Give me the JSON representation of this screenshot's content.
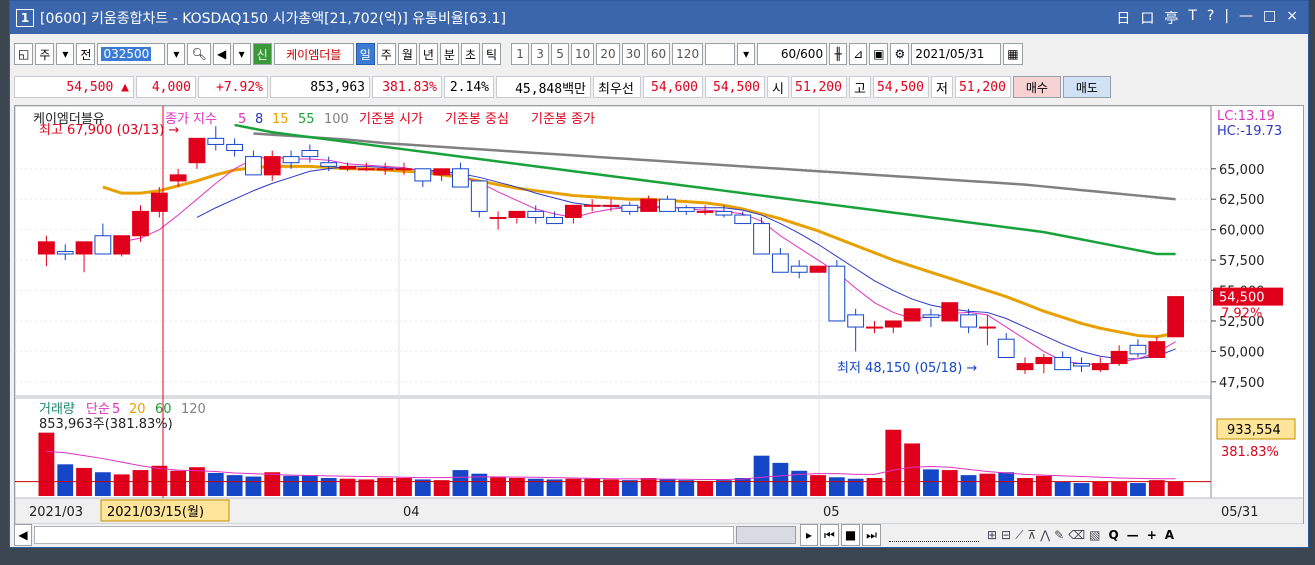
{
  "window": {
    "badge": "1",
    "title": "[0600] 키움종합차트 - KOSDAQ150 시가총액[21,702(억)] 유통비율[63.1]",
    "controls": [
      "日",
      "口",
      "亭",
      "T",
      "?",
      "|",
      "—",
      "□",
      "×"
    ]
  },
  "toolbar": {
    "item_jong": "주",
    "item_jeon": "전",
    "code": "032500",
    "shin": "신",
    "stock_name": "케이엠더블",
    "periods": [
      "일",
      "주",
      "월",
      "년",
      "분",
      "초",
      "틱"
    ],
    "active_period": "일",
    "minutes": [
      "1",
      "3",
      "5",
      "10",
      "20",
      "30",
      "60",
      "120"
    ],
    "count": "60",
    "count_total": "/600",
    "date": "2021/05/31"
  },
  "quote": {
    "price": "54,500",
    "change": "4,000",
    "rate": "+7.92%",
    "volume": "853,963",
    "vol_rate": "381.83%",
    "turnover": "2.14%",
    "amount": "45,848백만",
    "best_label": "최우선",
    "best_ask": "54,600",
    "best_bid": "54,500",
    "open_label": "시",
    "open": "51,200",
    "high_label": "고",
    "high": "54,500",
    "low_label": "저",
    "low": "51,200",
    "buy": "매수",
    "sell": "매도"
  },
  "chart_data": {
    "type": "candlestick",
    "price_legend": "케이엠더블유",
    "ma_legend": [
      "종가 지수",
      "5",
      "8",
      "15",
      "55",
      "100",
      "기준봉 시가",
      "기준봉 중심",
      "기준봉 종가"
    ],
    "lc": "LC:13.19",
    "hc": "HC:-19.73",
    "high_annot": "최고 67,900 (03/13) →",
    "low_annot": "최저 48,150 (05/18) →",
    "last_price": "54,500",
    "last_rate": "7.92%",
    "y_ticks": [
      "65,000",
      "62,500",
      "60,000",
      "57,500",
      "55,000",
      "52,500",
      "50,000",
      "47,500"
    ],
    "y_range": [
      46500,
      69500
    ],
    "vol_legend": [
      "거래량",
      "단순",
      "5",
      "20",
      "60",
      "120"
    ],
    "vol_annot": "853,963주(381.83%)",
    "vol_last": "933,554",
    "vol_rate": "381.83%",
    "vol_max": 1000000,
    "x_labels": [
      "2021/03",
      "04",
      "05",
      "05/31"
    ],
    "cursor_date": "2021/03/15(월)",
    "candles": [
      {
        "o": 58000,
        "h": 59500,
        "l": 57000,
        "c": 59000
      },
      {
        "o": 58200,
        "h": 58800,
        "l": 57500,
        "c": 58000
      },
      {
        "o": 58000,
        "h": 59000,
        "l": 56500,
        "c": 59000
      },
      {
        "o": 59500,
        "h": 60500,
        "l": 58000,
        "c": 58000
      },
      {
        "o": 58000,
        "h": 59500,
        "l": 57800,
        "c": 59500
      },
      {
        "o": 59500,
        "h": 62000,
        "l": 59000,
        "c": 61500
      },
      {
        "o": 61500,
        "h": 63500,
        "l": 61000,
        "c": 63000
      },
      {
        "o": 64000,
        "h": 65000,
        "l": 63500,
        "c": 64500
      },
      {
        "o": 65500,
        "h": 67500,
        "l": 65000,
        "c": 67500
      },
      {
        "o": 67500,
        "h": 68500,
        "l": 66500,
        "c": 67000
      },
      {
        "o": 67000,
        "h": 67500,
        "l": 66000,
        "c": 66500
      },
      {
        "o": 66000,
        "h": 66500,
        "l": 64500,
        "c": 64500
      },
      {
        "o": 64500,
        "h": 66500,
        "l": 64000,
        "c": 66000
      },
      {
        "o": 66000,
        "h": 66500,
        "l": 65000,
        "c": 65500
      },
      {
        "o": 66500,
        "h": 67000,
        "l": 65500,
        "c": 66000
      },
      {
        "o": 65500,
        "h": 66000,
        "l": 64800,
        "c": 65200
      },
      {
        "o": 65000,
        "h": 65500,
        "l": 64800,
        "c": 65200
      },
      {
        "o": 65000,
        "h": 65500,
        "l": 64800,
        "c": 65000
      },
      {
        "o": 65000,
        "h": 65500,
        "l": 64500,
        "c": 65000
      },
      {
        "o": 65000,
        "h": 65500,
        "l": 64500,
        "c": 65000
      },
      {
        "o": 65000,
        "h": 65000,
        "l": 63500,
        "c": 64000
      },
      {
        "o": 64500,
        "h": 65000,
        "l": 64000,
        "c": 65000
      },
      {
        "o": 65000,
        "h": 65500,
        "l": 63500,
        "c": 63500
      },
      {
        "o": 64000,
        "h": 64000,
        "l": 61000,
        "c": 61500
      },
      {
        "o": 61000,
        "h": 61500,
        "l": 60000,
        "c": 61000
      },
      {
        "o": 61000,
        "h": 61500,
        "l": 60500,
        "c": 61500
      },
      {
        "o": 61500,
        "h": 62000,
        "l": 60500,
        "c": 61000
      },
      {
        "o": 61000,
        "h": 61500,
        "l": 60500,
        "c": 60500
      },
      {
        "o": 61000,
        "h": 62000,
        "l": 60500,
        "c": 62000
      },
      {
        "o": 62000,
        "h": 62500,
        "l": 61500,
        "c": 62000
      },
      {
        "o": 62000,
        "h": 62500,
        "l": 61500,
        "c": 62000
      },
      {
        "o": 62000,
        "h": 62300,
        "l": 61200,
        "c": 61500
      },
      {
        "o": 61500,
        "h": 62800,
        "l": 61500,
        "c": 62500
      },
      {
        "o": 62500,
        "h": 62800,
        "l": 61500,
        "c": 61500
      },
      {
        "o": 61800,
        "h": 62000,
        "l": 61200,
        "c": 61500
      },
      {
        "o": 61500,
        "h": 62000,
        "l": 61200,
        "c": 61500
      },
      {
        "o": 61500,
        "h": 62000,
        "l": 61000,
        "c": 61200
      },
      {
        "o": 61200,
        "h": 61500,
        "l": 60500,
        "c": 60500
      },
      {
        "o": 60500,
        "h": 61000,
        "l": 58000,
        "c": 58000
      },
      {
        "o": 58000,
        "h": 58500,
        "l": 56500,
        "c": 56500
      },
      {
        "o": 57000,
        "h": 57500,
        "l": 56000,
        "c": 56500
      },
      {
        "o": 56500,
        "h": 57000,
        "l": 56500,
        "c": 57000
      },
      {
        "o": 57000,
        "h": 57500,
        "l": 52500,
        "c": 52500
      },
      {
        "o": 53000,
        "h": 53500,
        "l": 50000,
        "c": 52000
      },
      {
        "o": 52000,
        "h": 52500,
        "l": 51500,
        "c": 52000
      },
      {
        "o": 52000,
        "h": 52500,
        "l": 51500,
        "c": 52500
      },
      {
        "o": 52500,
        "h": 53500,
        "l": 52500,
        "c": 53500
      },
      {
        "o": 53000,
        "h": 53500,
        "l": 52000,
        "c": 52800
      },
      {
        "o": 52500,
        "h": 54000,
        "l": 52500,
        "c": 54000
      },
      {
        "o": 53000,
        "h": 53500,
        "l": 51500,
        "c": 52000
      },
      {
        "o": 52000,
        "h": 53000,
        "l": 50500,
        "c": 52000
      },
      {
        "o": 51000,
        "h": 51500,
        "l": 49500,
        "c": 49500
      },
      {
        "o": 48500,
        "h": 49500,
        "l": 48150,
        "c": 49000
      },
      {
        "o": 49000,
        "h": 49800,
        "l": 48200,
        "c": 49500
      },
      {
        "o": 49500,
        "h": 50000,
        "l": 48500,
        "c": 48500
      },
      {
        "o": 49000,
        "h": 49500,
        "l": 48300,
        "c": 48800
      },
      {
        "o": 48500,
        "h": 49500,
        "l": 48300,
        "c": 49000
      },
      {
        "o": 49000,
        "h": 50500,
        "l": 48800,
        "c": 50000
      },
      {
        "o": 50500,
        "h": 51000,
        "l": 49500,
        "c": 49800
      },
      {
        "o": 49500,
        "h": 51200,
        "l": 49500,
        "c": 50800
      },
      {
        "o": 51200,
        "h": 54500,
        "l": 51200,
        "c": 54500
      }
    ],
    "volumes": [
      880000,
      440000,
      390000,
      330000,
      300000,
      360000,
      420000,
      350000,
      400000,
      320000,
      290000,
      270000,
      330000,
      280000,
      290000,
      250000,
      240000,
      230000,
      250000,
      250000,
      230000,
      220000,
      360000,
      310000,
      260000,
      250000,
      240000,
      230000,
      240000,
      240000,
      230000,
      220000,
      250000,
      230000,
      220000,
      210000,
      220000,
      250000,
      560000,
      460000,
      350000,
      290000,
      260000,
      240000,
      250000,
      920000,
      730000,
      370000,
      360000,
      290000,
      310000,
      330000,
      250000,
      280000,
      200000,
      180000,
      200000,
      200000,
      180000,
      220000,
      200000
    ],
    "ma_gray": [
      null,
      null,
      null,
      null,
      null,
      null,
      null,
      null,
      null,
      null,
      null,
      67900,
      67800,
      67700,
      67600,
      67500,
      67400,
      67250,
      67100,
      67000,
      66900,
      66800,
      66700,
      66600,
      66500,
      66400,
      66300,
      66200,
      66100,
      66000,
      65900,
      65800,
      65700,
      65600,
      65500,
      65400,
      65300,
      65200,
      65100,
      65000,
      64900,
      64800,
      64700,
      64600,
      64500,
      64400,
      64300,
      64200,
      64100,
      64000,
      63900,
      63800,
      63700,
      63550,
      63400,
      63250,
      63100,
      62950,
      62800,
      62650,
      62500
    ],
    "ma_green": [
      null,
      null,
      null,
      null,
      null,
      null,
      null,
      null,
      null,
      null,
      68600,
      68300,
      68000,
      67800,
      67600,
      67400,
      67200,
      67000,
      66800,
      66600,
      66400,
      66200,
      66000,
      65800,
      65600,
      65400,
      65200,
      65000,
      64800,
      64600,
      64400,
      64200,
      64000,
      63800,
      63600,
      63400,
      63200,
      63000,
      62800,
      62600,
      62400,
      62200,
      62000,
      61800,
      61600,
      61400,
      61200,
      61000,
      60800,
      60600,
      60400,
      60200,
      60000,
      59800,
      59500,
      59200,
      58900,
      58600,
      58300,
      58000,
      58000
    ],
    "ma_orange": [
      null,
      null,
      null,
      63500,
      63000,
      63000,
      63200,
      63600,
      64000,
      64500,
      64900,
      65100,
      65200,
      65200,
      65200,
      65100,
      65000,
      65000,
      64900,
      64800,
      64700,
      64500,
      64300,
      64000,
      63700,
      63400,
      63200,
      63000,
      62800,
      62700,
      62600,
      62500,
      62500,
      62400,
      62300,
      62200,
      62000,
      61700,
      61300,
      60900,
      60400,
      59900,
      59300,
      58700,
      58100,
      57500,
      57000,
      56500,
      56000,
      55500,
      55000,
      54500,
      53900,
      53300,
      52800,
      52300,
      51900,
      51600,
      51300,
      51200,
      51500
    ],
    "ma_pink": [
      null,
      null,
      null,
      null,
      59000,
      59300,
      60000,
      61200,
      62500,
      63800,
      65000,
      65800,
      66000,
      65800,
      65800,
      65700,
      65400,
      65300,
      65200,
      65100,
      64800,
      64700,
      64400,
      63900,
      63100,
      62400,
      61700,
      61300,
      61000,
      61400,
      61700,
      61800,
      61900,
      61900,
      61700,
      61600,
      61500,
      61300,
      60700,
      59500,
      58500,
      57500,
      56500,
      55200,
      54000,
      53200,
      52700,
      52800,
      53100,
      53200,
      53000,
      52000,
      51000,
      50000,
      49200,
      49000,
      48900,
      49100,
      49400,
      49900,
      50800
    ],
    "ma_blue": [
      null,
      null,
      null,
      null,
      null,
      null,
      null,
      null,
      61000,
      61800,
      62500,
      63200,
      63800,
      64300,
      64800,
      65000,
      65200,
      65200,
      65100,
      65000,
      64900,
      64800,
      64600,
      64300,
      63900,
      63500,
      63000,
      62600,
      62200,
      62000,
      61900,
      61800,
      61800,
      61800,
      61800,
      61800,
      61800,
      61600,
      61200,
      60500,
      59700,
      58800,
      57800,
      56800,
      55800,
      55000,
      54300,
      53800,
      53500,
      53300,
      53200,
      52700,
      52000,
      51300,
      50600,
      50000,
      49600,
      49400,
      49400,
      49600,
      50200
    ],
    "vol_ma": [
      620000,
      600000,
      560000,
      520000,
      470000,
      420000,
      380000,
      360000,
      350000,
      340000,
      320000,
      310000,
      300000,
      290000,
      285000,
      280000,
      275000,
      270000,
      265000,
      260000,
      255000,
      255000,
      260000,
      265000,
      265000,
      262000,
      260000,
      255000,
      250000,
      245000,
      240000,
      238000,
      236000,
      234000,
      232000,
      230000,
      230000,
      235000,
      260000,
      280000,
      300000,
      310000,
      310000,
      300000,
      300000,
      360000,
      400000,
      410000,
      400000,
      370000,
      340000,
      320000,
      300000,
      290000,
      280000,
      270000,
      260000,
      250000,
      245000,
      240000,
      240000
    ]
  },
  "bottom": {
    "nav_buttons": [
      "▸",
      "⏮",
      "■",
      "⏭"
    ],
    "zoom_tools": [
      "Q",
      "—",
      "+",
      "A"
    ]
  }
}
